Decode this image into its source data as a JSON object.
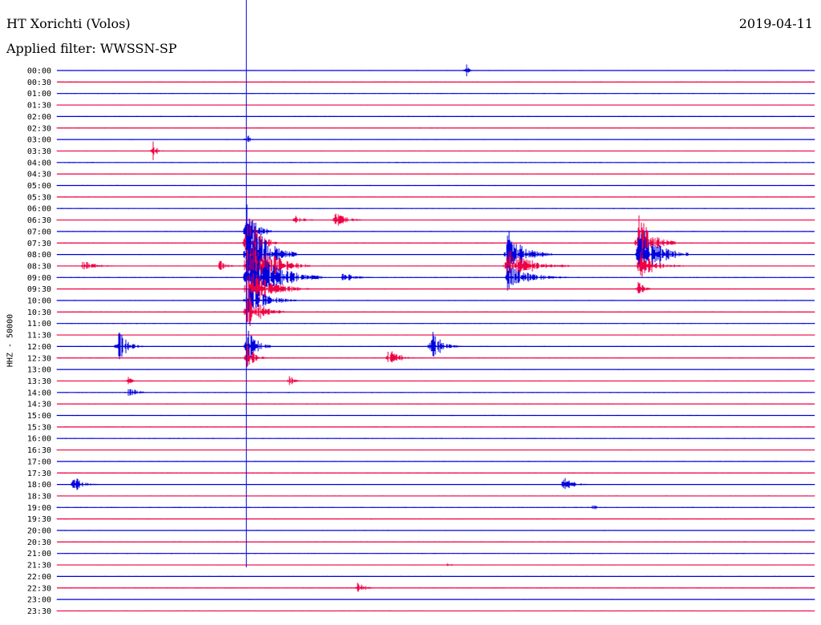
{
  "header": {
    "station": "HT Xorichti (Volos)",
    "filter": "Applied filter: WWSSN-SP",
    "date": "2019-04-11"
  },
  "chart_data": {
    "type": "seismogram",
    "ylabel": "HHZ - 50000",
    "line_colors": [
      "#0000dd",
      "#ee0044"
    ],
    "time_labels": [
      "00:00",
      "00:30",
      "01:00",
      "01:30",
      "02:00",
      "02:30",
      "03:00",
      "03:30",
      "04:00",
      "04:30",
      "05:00",
      "05:30",
      "06:00",
      "06:30",
      "07:00",
      "07:30",
      "08:00",
      "08:30",
      "09:00",
      "09:30",
      "10:00",
      "10:30",
      "11:00",
      "11:30",
      "12:00",
      "12:30",
      "13:00",
      "13:30",
      "14:00",
      "14:30",
      "15:00",
      "15:30",
      "16:00",
      "16:30",
      "17:00",
      "17:30",
      "18:00",
      "18:30",
      "19:00",
      "19:30",
      "20:00",
      "20:30",
      "21:00",
      "21:30",
      "22:00",
      "22:30",
      "23:00",
      "23:30"
    ],
    "marker_minute": 7.5,
    "events": [
      {
        "row": 0,
        "minute": 16.2,
        "amp": 10,
        "dur": 0.3
      },
      {
        "row": 6,
        "minute": 7.5,
        "amp": 14,
        "dur": 0.3
      },
      {
        "row": 7,
        "minute": 3.8,
        "amp": 14,
        "dur": 0.4
      },
      {
        "row": 13,
        "minute": 9.4,
        "amp": 8,
        "dur": 1.0
      },
      {
        "row": 13,
        "minute": 11.0,
        "amp": 12,
        "dur": 1.2
      },
      {
        "row": 14,
        "minute": 7.5,
        "amp": 40,
        "dur": 1.0
      },
      {
        "row": 15,
        "minute": 7.5,
        "amp": 50,
        "dur": 1.2
      },
      {
        "row": 16,
        "minute": 7.5,
        "amp": 60,
        "dur": 2.0
      },
      {
        "row": 17,
        "minute": 7.5,
        "amp": 50,
        "dur": 2.5
      },
      {
        "row": 18,
        "minute": 7.5,
        "amp": 45,
        "dur": 3.0
      },
      {
        "row": 19,
        "minute": 7.5,
        "amp": 30,
        "dur": 2.5
      },
      {
        "row": 20,
        "minute": 7.5,
        "amp": 25,
        "dur": 2.0
      },
      {
        "row": 21,
        "minute": 7.5,
        "amp": 30,
        "dur": 1.5
      },
      {
        "row": 24,
        "minute": 7.5,
        "amp": 30,
        "dur": 1.0
      },
      {
        "row": 25,
        "minute": 7.5,
        "amp": 20,
        "dur": 0.8
      },
      {
        "row": 17,
        "minute": 1.0,
        "amp": 7,
        "dur": 1.6
      },
      {
        "row": 17,
        "minute": 6.4,
        "amp": 9,
        "dur": 1.0
      },
      {
        "row": 18,
        "minute": 11.3,
        "amp": 7,
        "dur": 1.5
      },
      {
        "row": 16,
        "minute": 17.8,
        "amp": 35,
        "dur": 1.8
      },
      {
        "row": 17,
        "minute": 17.8,
        "amp": 25,
        "dur": 2.5
      },
      {
        "row": 18,
        "minute": 17.8,
        "amp": 18,
        "dur": 2.5
      },
      {
        "row": 15,
        "minute": 23.0,
        "amp": 40,
        "dur": 1.5
      },
      {
        "row": 16,
        "minute": 23.0,
        "amp": 45,
        "dur": 2.0
      },
      {
        "row": 17,
        "minute": 23.0,
        "amp": 22,
        "dur": 1.8
      },
      {
        "row": 19,
        "minute": 23.0,
        "amp": 12,
        "dur": 0.6
      },
      {
        "row": 24,
        "minute": 2.4,
        "amp": 25,
        "dur": 1.0
      },
      {
        "row": 27,
        "minute": 2.8,
        "amp": 6,
        "dur": 0.5
      },
      {
        "row": 28,
        "minute": 2.8,
        "amp": 8,
        "dur": 1.0
      },
      {
        "row": 25,
        "minute": 13.1,
        "amp": 14,
        "dur": 1.2
      },
      {
        "row": 24,
        "minute": 14.8,
        "amp": 24,
        "dur": 1.2
      },
      {
        "row": 27,
        "minute": 9.2,
        "amp": 12,
        "dur": 0.5
      },
      {
        "row": 36,
        "minute": 0.6,
        "amp": 14,
        "dur": 1.0
      },
      {
        "row": 36,
        "minute": 20.0,
        "amp": 14,
        "dur": 1.0
      },
      {
        "row": 38,
        "minute": 21.2,
        "amp": 5,
        "dur": 0.6
      },
      {
        "row": 45,
        "minute": 11.9,
        "amp": 8,
        "dur": 0.8
      },
      {
        "row": 43,
        "minute": 15.4,
        "amp": 3,
        "dur": 0.6
      }
    ]
  }
}
